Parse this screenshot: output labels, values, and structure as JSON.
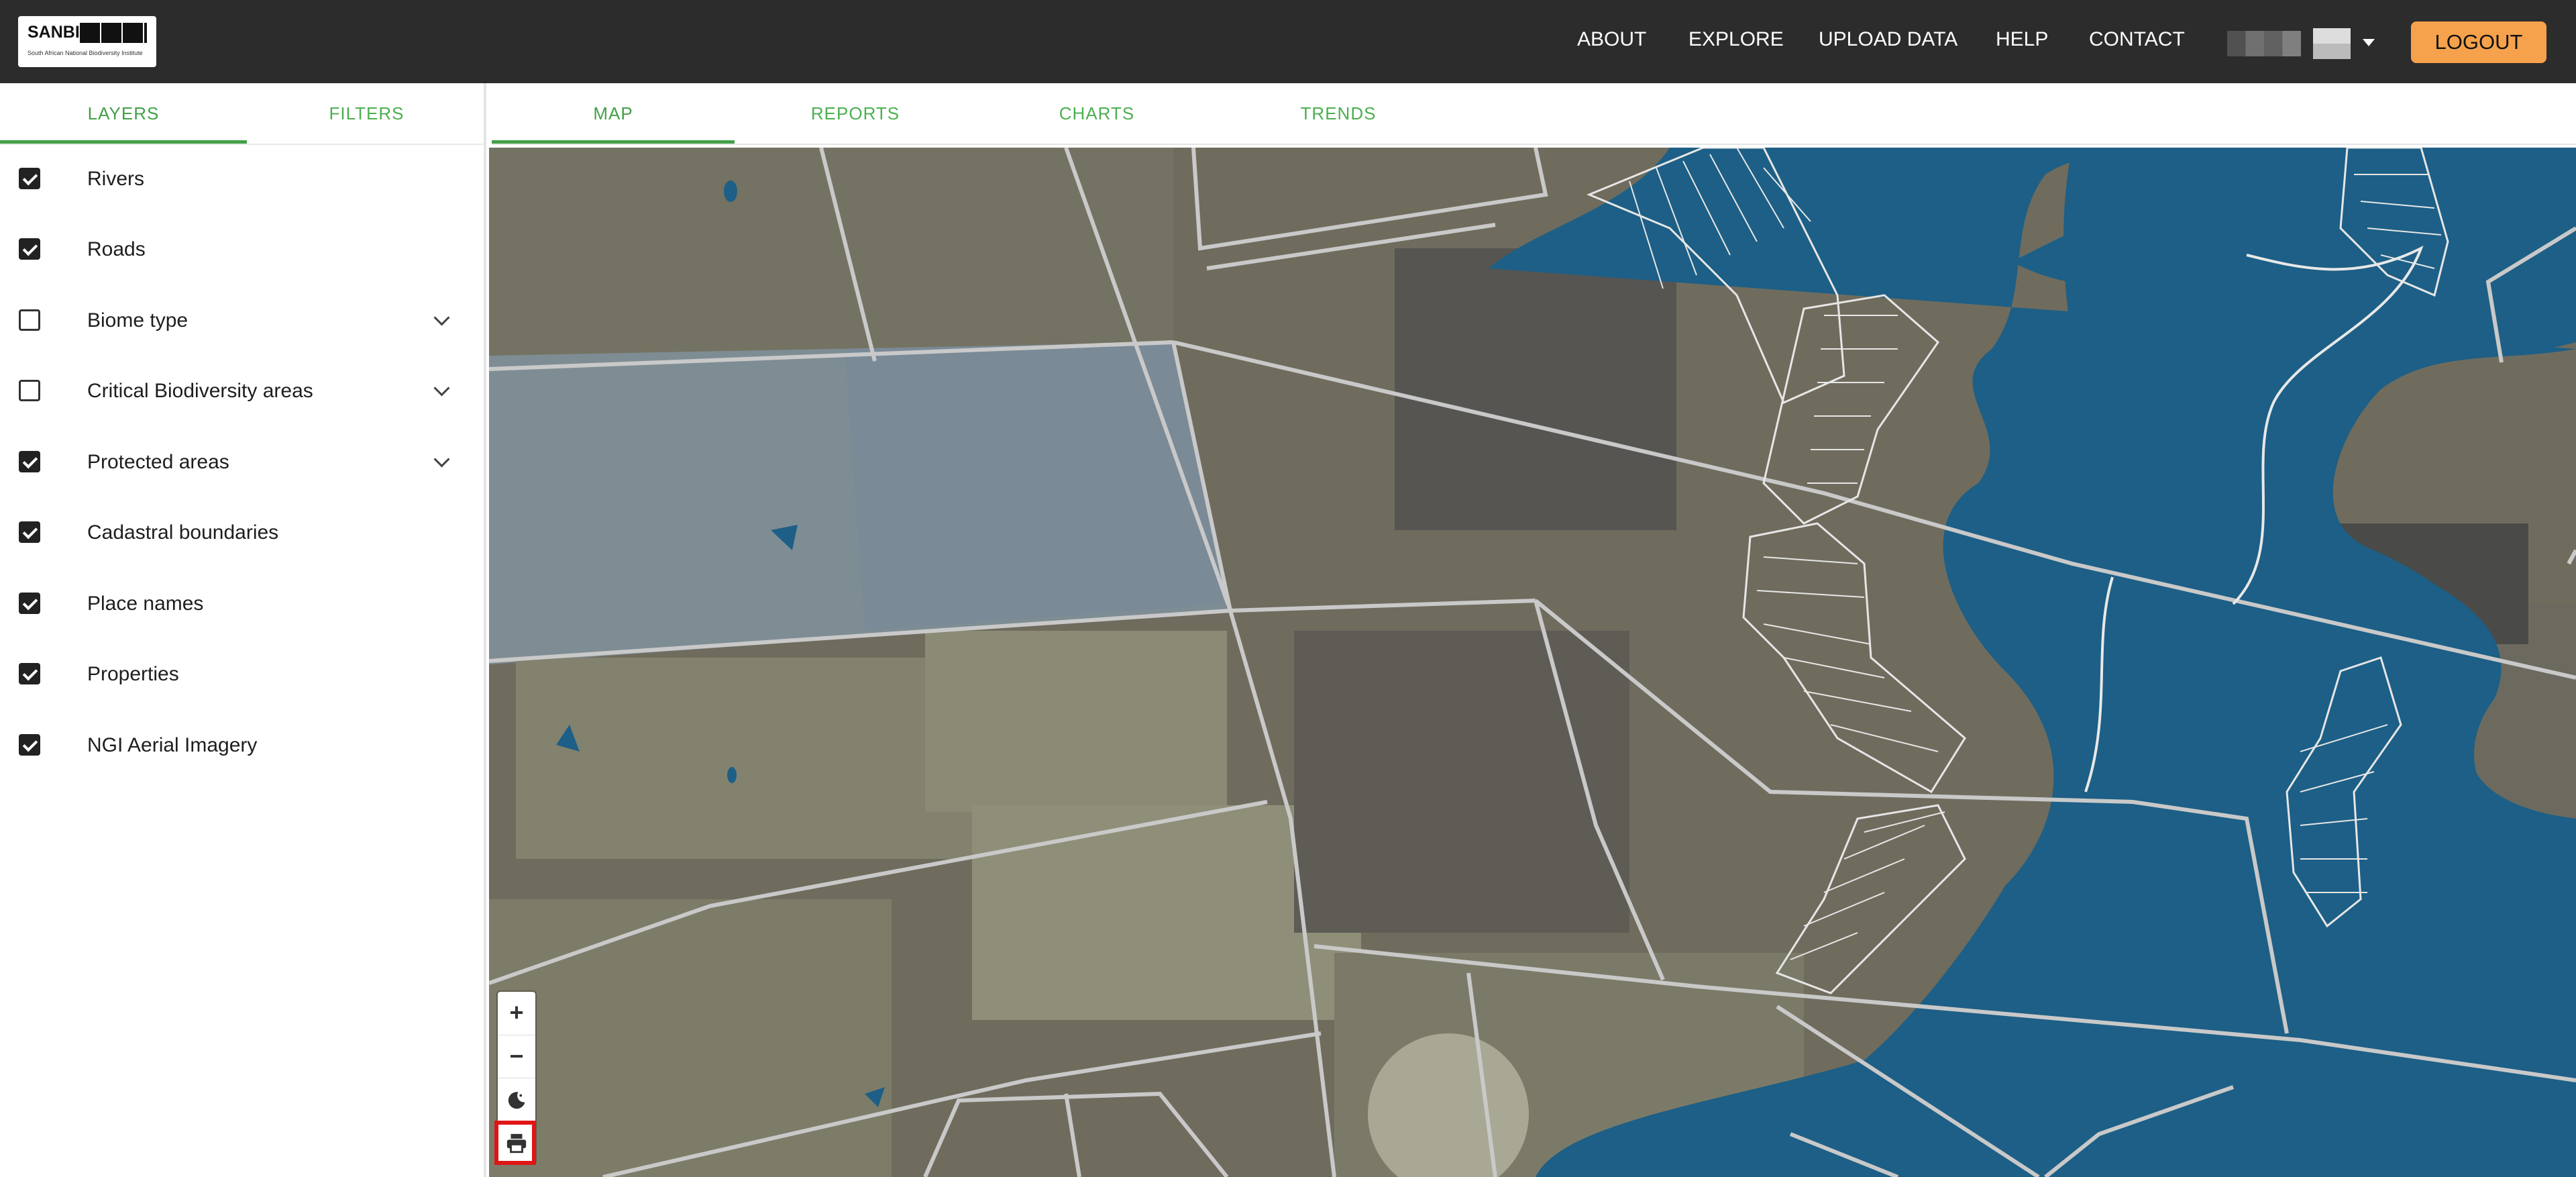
{
  "header": {
    "logo_text": "SANBI",
    "logo_tagline": "South African National Biodiversity Institute",
    "nav": [
      "ABOUT",
      "EXPLORE",
      "UPLOAD DATA",
      "HELP",
      "CONTACT"
    ],
    "logout_label": "LOGOUT"
  },
  "sidebar": {
    "tabs": [
      "LAYERS",
      "FILTERS"
    ],
    "active_tab": "LAYERS",
    "layers": [
      {
        "label": "Rivers",
        "checked": true,
        "expandable": false
      },
      {
        "label": "Roads",
        "checked": true,
        "expandable": false
      },
      {
        "label": "Biome type",
        "checked": false,
        "expandable": true
      },
      {
        "label": "Critical Biodiversity areas",
        "checked": false,
        "expandable": true
      },
      {
        "label": "Protected areas",
        "checked": true,
        "expandable": true
      },
      {
        "label": "Cadastral boundaries",
        "checked": true,
        "expandable": false
      },
      {
        "label": "Place names",
        "checked": true,
        "expandable": false
      },
      {
        "label": "Properties",
        "checked": true,
        "expandable": false
      },
      {
        "label": "NGI Aerial Imagery",
        "checked": true,
        "expandable": false
      }
    ]
  },
  "main_tabs": [
    "MAP",
    "REPORTS",
    "CHARTS",
    "TRENDS"
  ],
  "active_main_tab": "MAP",
  "map_controls": {
    "zoom_in": "+",
    "zoom_out": "−",
    "icons": [
      "dark-mode-icon",
      "print-icon"
    ]
  },
  "colors": {
    "header_bg": "#2c2c2c",
    "accent_green": "#43a047",
    "logout_orange": "#f6a24c",
    "water_blue": "#1d5f86",
    "highlight_red": "#e01515"
  }
}
